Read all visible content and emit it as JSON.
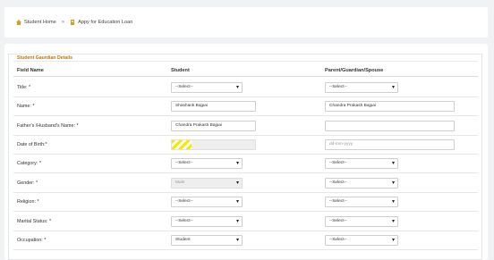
{
  "breadcrumb": {
    "home_label": "Student Home",
    "separator": "»",
    "current_label": "Appy for Education Loan"
  },
  "section": {
    "title": "Student Gaurdian Details"
  },
  "columns": {
    "field": "Field Name",
    "student": "Student",
    "parent": "Parent/Guardian/Spouse"
  },
  "rows": [
    {
      "label": "Title: *",
      "student": "--Select--",
      "parent": "--Select--"
    },
    {
      "label": "Name: *",
      "student": "Shashank Bajpai",
      "parent": "Chandra Prakash Bajpai"
    },
    {
      "label": "Father's /Husband's Name: *",
      "student": "Chandra Prakash Bajpai",
      "parent": ""
    },
    {
      "label": "Date of Birth:*",
      "student": "",
      "parent_placeholder": "dd-mm-yyyy"
    },
    {
      "label": "Category: *",
      "student": "--Select--",
      "parent": "--Select--"
    },
    {
      "label": "Gender: *",
      "student": "Male",
      "parent": "--Select--"
    },
    {
      "label": "Religion: *",
      "student": "--Select--",
      "parent": "--Select--"
    },
    {
      "label": "Marital Status: *",
      "student": "--Select--",
      "parent": "--Select--"
    },
    {
      "label": "Occupation: *",
      "student": "Student",
      "parent": "--Select--"
    }
  ],
  "colors": {
    "section_title": "#b9770e",
    "home_icon": "#c9a227",
    "doc_icon": "#c9a227",
    "dob_stripe": "#f5e900"
  },
  "icons": {
    "home": "home-icon",
    "document": "document-icon",
    "dropdown": "chevron-down-icon"
  }
}
